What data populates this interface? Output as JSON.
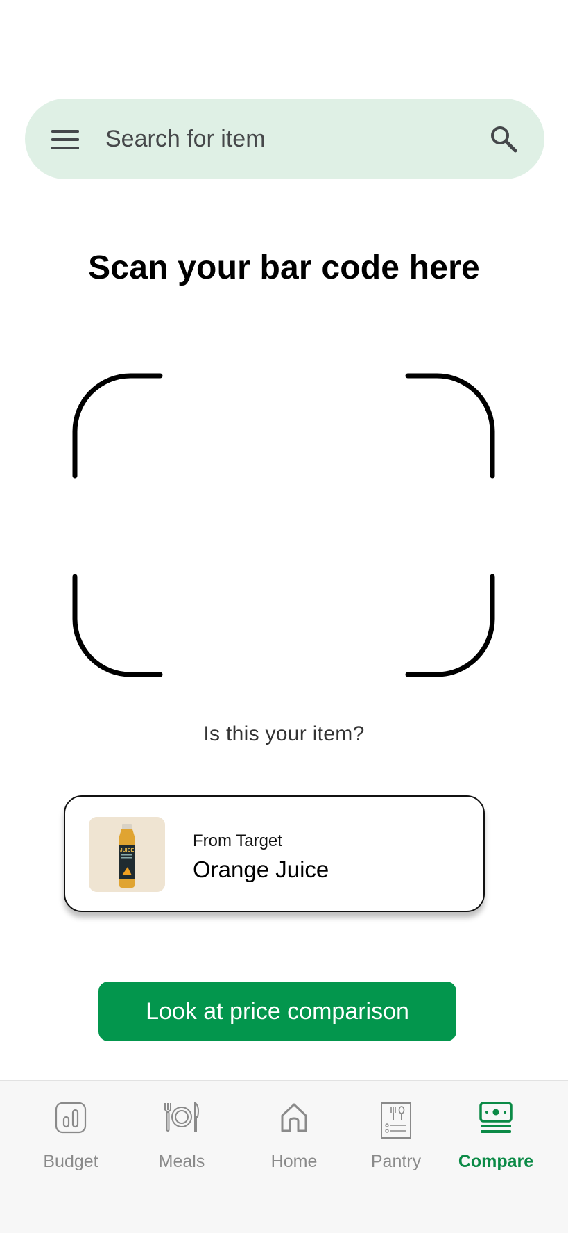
{
  "search": {
    "placeholder": "Search for item"
  },
  "scanner": {
    "title": "Scan your bar code here",
    "prompt": "Is this your item?"
  },
  "product": {
    "source": "From Target",
    "name": "Orange Juice",
    "thumb_label": "JUICE"
  },
  "actions": {
    "compare_label": "Look at price comparison"
  },
  "nav": {
    "items": [
      {
        "label": "Budget",
        "icon": "budget-icon"
      },
      {
        "label": "Meals",
        "icon": "meals-icon"
      },
      {
        "label": "Home",
        "icon": "home-icon"
      },
      {
        "label": "Pantry",
        "icon": "pantry-icon"
      },
      {
        "label": "Compare",
        "icon": "compare-icon"
      }
    ],
    "active": "Compare"
  },
  "colors": {
    "accent": "#03964d",
    "search_bg": "#dff0e5",
    "nav_active": "#0b8a46",
    "nav_inactive": "#8a8a8a"
  }
}
